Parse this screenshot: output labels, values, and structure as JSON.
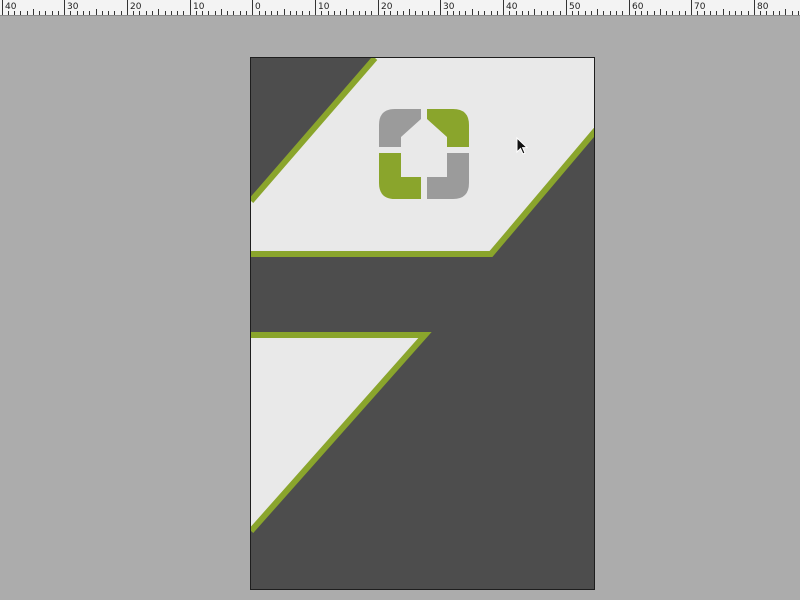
{
  "ruler": {
    "labels": [
      "40",
      "30",
      "20",
      "10",
      "0",
      "10",
      "20",
      "30",
      "40",
      "50",
      "60",
      "70",
      "80"
    ]
  },
  "colors": {
    "workspace": "#acacac",
    "page_dark": "#4d4d4d",
    "panel_light": "#e9e9e9",
    "accent_green": "#8aa52c",
    "logo_gray": "#9b9b9b"
  },
  "icons": {
    "logo": "house-logo-icon",
    "cursor": "arrow-cursor-icon"
  }
}
